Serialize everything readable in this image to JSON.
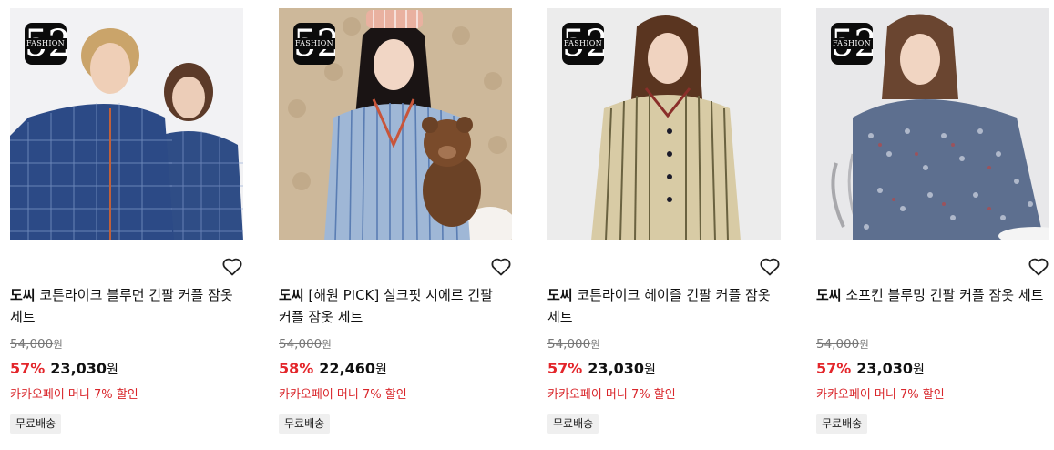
{
  "products": [
    {
      "brand": "도씨",
      "name": " 코튼라이크 블루먼 긴팔 커플 잠옷 세트",
      "original_price": "54,000",
      "original_unit": "원",
      "discount_rate": "57%",
      "sale_price": "23,030",
      "sale_unit": "원",
      "promo": "카카오페이 머니 7% 할인",
      "shipping": "무료배송",
      "badge_number": "52",
      "badge_text": "FASHION",
      "image": "couple in blue plaid pajamas"
    },
    {
      "brand": "도씨",
      "name": " [해원 PICK] 실크핏 시에르 긴팔 커플 잠옷 세트",
      "original_price": "54,000",
      "original_unit": "원",
      "discount_rate": "58%",
      "sale_price": "22,460",
      "sale_unit": "원",
      "promo": "카카오페이 머니 7% 할인",
      "shipping": "무료배송",
      "badge_number": "52",
      "badge_text": "FASHION",
      "image": "woman in blue striped pajamas holding teddy bear"
    },
    {
      "brand": "도씨",
      "name": " 코튼라이크 헤이즐 긴팔 커플 잠옷 세트",
      "original_price": "54,000",
      "original_unit": "원",
      "discount_rate": "57%",
      "sale_price": "23,030",
      "sale_unit": "원",
      "promo": "카카오페이 머니 7% 할인",
      "shipping": "무료배송",
      "badge_number": "52",
      "badge_text": "FASHION",
      "image": "woman in beige striped pajamas"
    },
    {
      "brand": "도씨",
      "name": " 소프킨 블루밍 긴팔 커플 잠옷 세트",
      "original_price": "54,000",
      "original_unit": "원",
      "discount_rate": "57%",
      "sale_price": "23,030",
      "sale_unit": "원",
      "promo": "카카오페이 머니 7% 할인",
      "shipping": "무료배송",
      "badge_number": "52",
      "badge_text": "FASHION",
      "image": "woman in blue floral pajamas"
    }
  ],
  "colors": {
    "discount": "#e3262b",
    "promo": "#d9262b",
    "strike": "#777777",
    "ship_bg": "#efefef"
  },
  "icons": {
    "wishlist": "heart-outline-icon",
    "badge": "fashion-52-logo"
  }
}
